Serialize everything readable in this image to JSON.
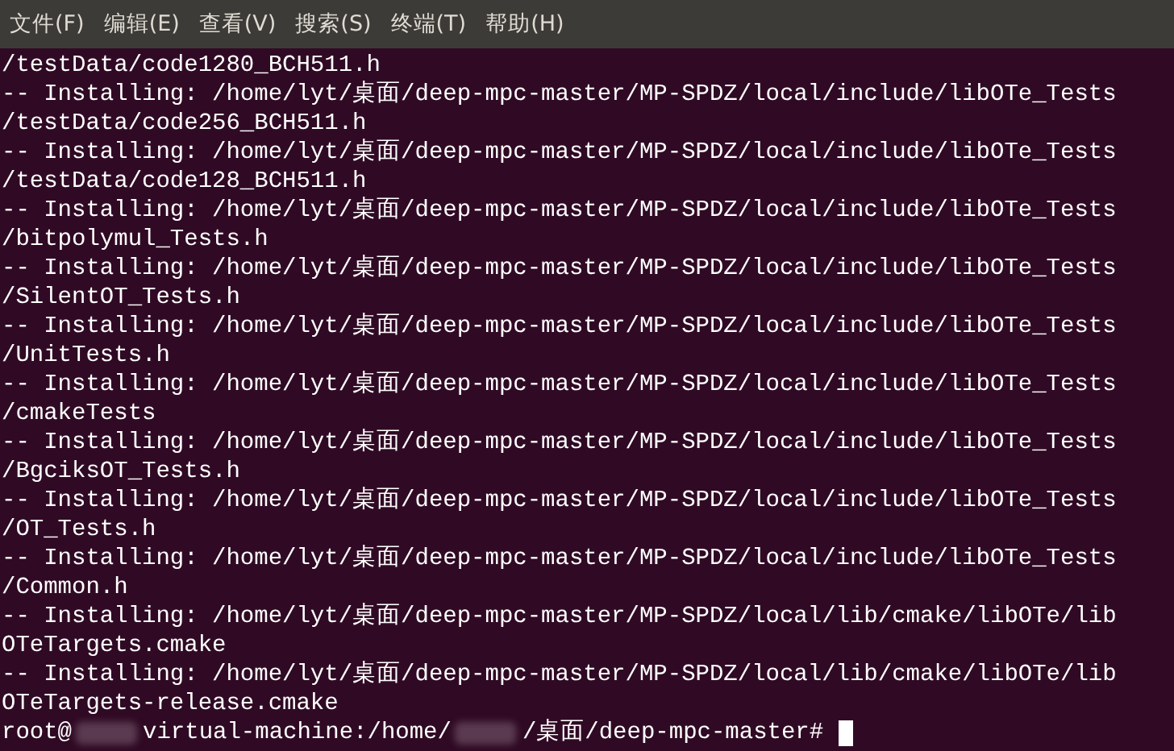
{
  "menu_bar": [
    "文件(F)",
    "编辑(E)",
    "查看(V)",
    "搜索(S)",
    "终端(T)",
    "帮助(H)"
  ],
  "terminal": {
    "lines": [
      "/testData/code1280_BCH511.h",
      "-- Installing: /home/lyt/桌面/deep-mpc-master/MP-SPDZ/local/include/libOTe_Tests",
      "/testData/code256_BCH511.h",
      "-- Installing: /home/lyt/桌面/deep-mpc-master/MP-SPDZ/local/include/libOTe_Tests",
      "/testData/code128_BCH511.h",
      "-- Installing: /home/lyt/桌面/deep-mpc-master/MP-SPDZ/local/include/libOTe_Tests",
      "/bitpolymul_Tests.h",
      "-- Installing: /home/lyt/桌面/deep-mpc-master/MP-SPDZ/local/include/libOTe_Tests",
      "/SilentOT_Tests.h",
      "-- Installing: /home/lyt/桌面/deep-mpc-master/MP-SPDZ/local/include/libOTe_Tests",
      "/UnitTests.h",
      "-- Installing: /home/lyt/桌面/deep-mpc-master/MP-SPDZ/local/include/libOTe_Tests",
      "/cmakeTests",
      "-- Installing: /home/lyt/桌面/deep-mpc-master/MP-SPDZ/local/include/libOTe_Tests",
      "/BgciksOT_Tests.h",
      "-- Installing: /home/lyt/桌面/deep-mpc-master/MP-SPDZ/local/include/libOTe_Tests",
      "/OT_Tests.h",
      "-- Installing: /home/lyt/桌面/deep-mpc-master/MP-SPDZ/local/include/libOTe_Tests",
      "/Common.h",
      "-- Installing: /home/lyt/桌面/deep-mpc-master/MP-SPDZ/local/lib/cmake/libOTe/lib",
      "OTeTargets.cmake",
      "-- Installing: /home/lyt/桌面/deep-mpc-master/MP-SPDZ/local/lib/cmake/libOTe/lib",
      "OTeTargets-release.cmake"
    ],
    "prompt": [
      {
        "kind": "text",
        "text": "root@"
      },
      {
        "kind": "redacted"
      },
      {
        "kind": "text",
        "text": "virtual-machine:/home/"
      },
      {
        "kind": "redacted"
      },
      {
        "kind": "text",
        "text": "/桌面/deep-mpc-master#"
      },
      {
        "kind": "cursor"
      }
    ]
  }
}
